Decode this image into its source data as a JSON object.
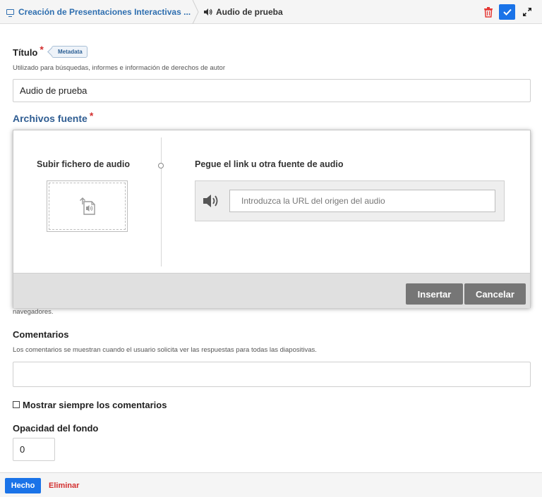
{
  "topbar": {
    "breadcrumb_parent": "Creación de Presentaciones Interactivas ...",
    "breadcrumb_current": "Audio de prueba"
  },
  "title_field": {
    "label": "Título",
    "required_mark": "*",
    "tag": "Metadata",
    "description": "Utilizado para búsquedas, informes e información de derechos de autor",
    "value": "Audio de prueba"
  },
  "source_files": {
    "label": "Archivos fuente",
    "required_mark": "*"
  },
  "modal": {
    "upload_title": "Subir fichero de audio",
    "link_title": "Pegue el link u otra fuente de audio",
    "url_placeholder": "Introduzca la URL del origen del audio",
    "insert_label": "Insertar",
    "cancel_label": "Cancelar"
  },
  "hidden_text_tail": "navegadores.",
  "comments": {
    "label": "Comentarios",
    "description": "Los comentarios se muestran cuando el usuario solicita ver las respuestas para todas las diapositivas.",
    "value": ""
  },
  "always_show": {
    "label": "Mostrar siempre los comentarios",
    "checked": false
  },
  "opacity": {
    "label": "Opacidad del fondo",
    "value": "0"
  },
  "bottombar": {
    "done_label": "Hecho",
    "delete_label": "Eliminar"
  },
  "colors": {
    "accent": "#1a73e8",
    "link": "#2f6fb0",
    "danger": "#d32f2f",
    "section_title": "#2f5d92"
  }
}
